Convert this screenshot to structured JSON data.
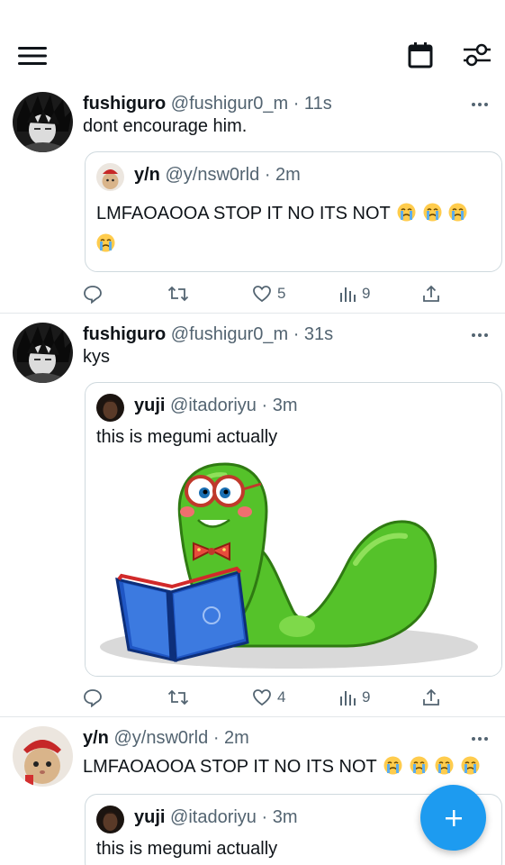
{
  "header": {
    "menu_icon": "hamburger-menu-icon",
    "calendar_icon": "calendar-icon",
    "filter_icon": "timeline-settings-icon"
  },
  "tweets": [
    {
      "name": "fushiguro",
      "handle": "@fushigur0_m",
      "time": "· 11s",
      "text": "dont encourage him.",
      "quote": {
        "name": "y/n",
        "handle": "@y/nsw0rld",
        "time": "· 2m",
        "text": "LMFAOAOOA STOP IT NO ITS NOT"
      },
      "likes": "5",
      "views": "9"
    },
    {
      "name": "fushiguro",
      "handle": "@fushigur0_m",
      "time": "· 31s",
      "text": "kys",
      "quote": {
        "name": "yuji",
        "handle": "@itadoriyu",
        "time": "· 3m",
        "text": "this is megumi actually",
        "media": "cartoon green worm with glasses reading a blue book"
      },
      "likes": "4",
      "views": "9"
    },
    {
      "name": "y/n",
      "handle": "@y/nsw0rld",
      "time": "· 2m",
      "text": "LMFAOAOOA STOP IT NO ITS NOT",
      "quote": {
        "name": "yuji",
        "handle": "@itadoriyu",
        "time": "· 3m",
        "text": "this is megumi actually"
      }
    }
  ],
  "colors": {
    "accent": "#1d9bf0",
    "muted": "#536471",
    "divider": "#e3e7ea"
  }
}
